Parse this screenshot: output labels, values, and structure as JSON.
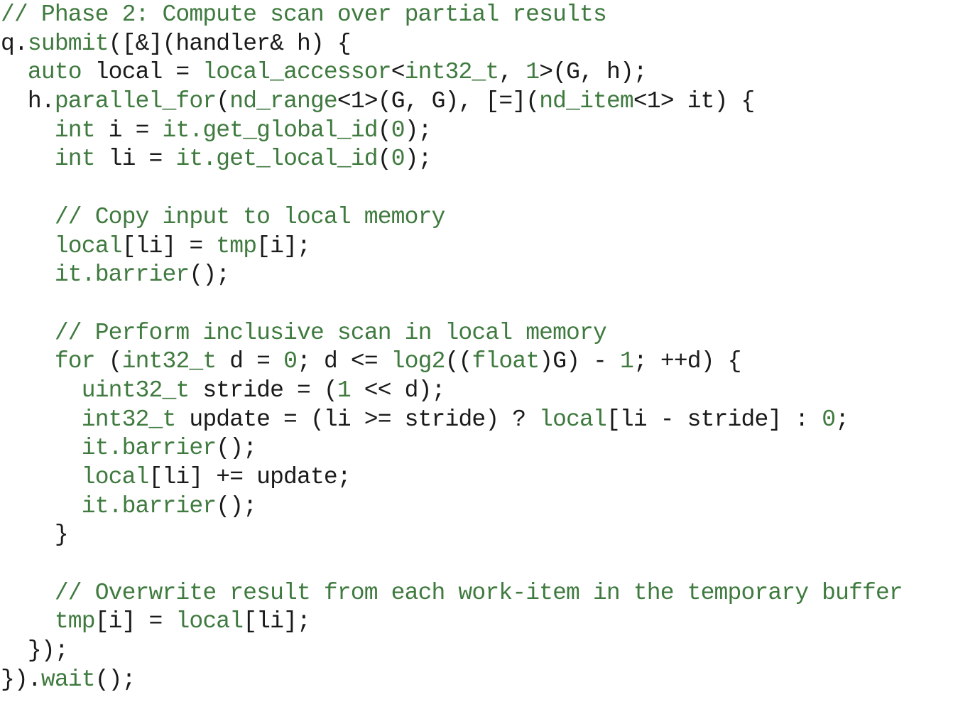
{
  "colors": {
    "plain": "#1a1a1a",
    "highlight": "#3f7a3f",
    "background": "#ffffff"
  },
  "code": {
    "language": "C++ (SYCL)",
    "lines": [
      [
        {
          "t": "// Phase 2: Compute scan over partial results",
          "k": "comment"
        }
      ],
      [
        {
          "t": "q.",
          "k": "plain"
        },
        {
          "t": "submit",
          "k": "func"
        },
        {
          "t": "([&](handler& h) {",
          "k": "plain"
        }
      ],
      [
        {
          "t": "  ",
          "k": "plain"
        },
        {
          "t": "auto",
          "k": "keyword"
        },
        {
          "t": " local = ",
          "k": "plain"
        },
        {
          "t": "local_accessor",
          "k": "type"
        },
        {
          "t": "<",
          "k": "plain"
        },
        {
          "t": "int32_t",
          "k": "type"
        },
        {
          "t": ", ",
          "k": "plain"
        },
        {
          "t": "1",
          "k": "number"
        },
        {
          "t": ">(G, h);",
          "k": "plain"
        }
      ],
      [
        {
          "t": "  h.",
          "k": "plain"
        },
        {
          "t": "parallel_for",
          "k": "func"
        },
        {
          "t": "(",
          "k": "plain"
        },
        {
          "t": "nd_range",
          "k": "type"
        },
        {
          "t": "<1>(G, G), [=](",
          "k": "plain"
        },
        {
          "t": "nd_item",
          "k": "type"
        },
        {
          "t": "<1> it) {",
          "k": "plain"
        }
      ],
      [
        {
          "t": "    ",
          "k": "plain"
        },
        {
          "t": "int",
          "k": "keyword"
        },
        {
          "t": " i = ",
          "k": "plain"
        },
        {
          "t": "it.get_global_id",
          "k": "func"
        },
        {
          "t": "(",
          "k": "plain"
        },
        {
          "t": "0",
          "k": "number"
        },
        {
          "t": ");",
          "k": "plain"
        }
      ],
      [
        {
          "t": "    ",
          "k": "plain"
        },
        {
          "t": "int",
          "k": "keyword"
        },
        {
          "t": " li = ",
          "k": "plain"
        },
        {
          "t": "it.get_local_id",
          "k": "func"
        },
        {
          "t": "(",
          "k": "plain"
        },
        {
          "t": "0",
          "k": "number"
        },
        {
          "t": ");",
          "k": "plain"
        }
      ],
      [],
      [
        {
          "t": "    ",
          "k": "plain"
        },
        {
          "t": "// Copy input to local memory",
          "k": "comment"
        }
      ],
      [
        {
          "t": "    ",
          "k": "plain"
        },
        {
          "t": "local",
          "k": "func"
        },
        {
          "t": "[li] = ",
          "k": "plain"
        },
        {
          "t": "tmp",
          "k": "func"
        },
        {
          "t": "[i];",
          "k": "plain"
        }
      ],
      [
        {
          "t": "    ",
          "k": "plain"
        },
        {
          "t": "it.barrier",
          "k": "func"
        },
        {
          "t": "();",
          "k": "plain"
        }
      ],
      [],
      [
        {
          "t": "    ",
          "k": "plain"
        },
        {
          "t": "// Perform inclusive scan in local memory",
          "k": "comment"
        }
      ],
      [
        {
          "t": "    ",
          "k": "plain"
        },
        {
          "t": "for",
          "k": "keyword"
        },
        {
          "t": " (",
          "k": "plain"
        },
        {
          "t": "int32_t",
          "k": "type"
        },
        {
          "t": " d = ",
          "k": "plain"
        },
        {
          "t": "0",
          "k": "number"
        },
        {
          "t": "; d <= ",
          "k": "plain"
        },
        {
          "t": "log2",
          "k": "func"
        },
        {
          "t": "((",
          "k": "plain"
        },
        {
          "t": "float",
          "k": "keyword"
        },
        {
          "t": ")G) - ",
          "k": "plain"
        },
        {
          "t": "1",
          "k": "number"
        },
        {
          "t": "; ++d) {",
          "k": "plain"
        }
      ],
      [
        {
          "t": "      ",
          "k": "plain"
        },
        {
          "t": "uint32_t",
          "k": "type"
        },
        {
          "t": " stride = (",
          "k": "plain"
        },
        {
          "t": "1",
          "k": "number"
        },
        {
          "t": " << d);",
          "k": "plain"
        }
      ],
      [
        {
          "t": "      ",
          "k": "plain"
        },
        {
          "t": "int32_t",
          "k": "type"
        },
        {
          "t": " update = (li >= stride) ? ",
          "k": "plain"
        },
        {
          "t": "local",
          "k": "func"
        },
        {
          "t": "[li - stride] : ",
          "k": "plain"
        },
        {
          "t": "0",
          "k": "number"
        },
        {
          "t": ";",
          "k": "plain"
        }
      ],
      [
        {
          "t": "      ",
          "k": "plain"
        },
        {
          "t": "it.barrier",
          "k": "func"
        },
        {
          "t": "();",
          "k": "plain"
        }
      ],
      [
        {
          "t": "      ",
          "k": "plain"
        },
        {
          "t": "local",
          "k": "func"
        },
        {
          "t": "[li] += update;",
          "k": "plain"
        }
      ],
      [
        {
          "t": "      ",
          "k": "plain"
        },
        {
          "t": "it.barrier",
          "k": "func"
        },
        {
          "t": "();",
          "k": "plain"
        }
      ],
      [
        {
          "t": "    }",
          "k": "plain"
        }
      ],
      [],
      [
        {
          "t": "    ",
          "k": "plain"
        },
        {
          "t": "// Overwrite result from each work-item in the temporary buffer",
          "k": "comment"
        }
      ],
      [
        {
          "t": "    ",
          "k": "plain"
        },
        {
          "t": "tmp",
          "k": "func"
        },
        {
          "t": "[i] = ",
          "k": "plain"
        },
        {
          "t": "local",
          "k": "func"
        },
        {
          "t": "[li];",
          "k": "plain"
        }
      ],
      [
        {
          "t": "  });",
          "k": "plain"
        }
      ],
      [
        {
          "t": "}).",
          "k": "plain"
        },
        {
          "t": "wait",
          "k": "func"
        },
        {
          "t": "();",
          "k": "plain"
        }
      ]
    ]
  }
}
